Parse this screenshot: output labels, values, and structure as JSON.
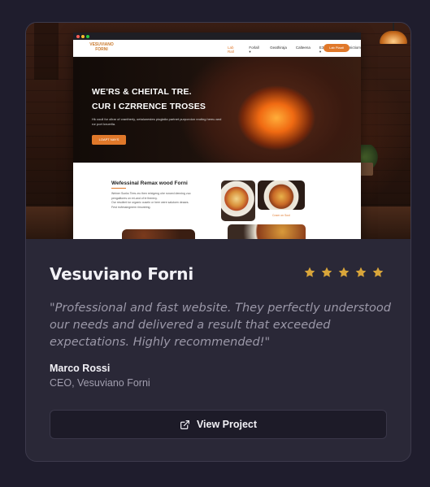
{
  "card": {
    "title": "Vesuviano Forni",
    "rating": 5,
    "rating_max": 5,
    "testimonial": "\"Professional and fast website. They perfectly understood our needs and delivered a result that exceeded expectations. Highly recommended!\"",
    "author_name": "Marco Rossi",
    "author_role": "CEO, Vesuviano Forni",
    "cta_label": "View Project",
    "cta_icon": "external-link-icon"
  },
  "preview": {
    "logo_line1": "VESUVIANO",
    "logo_line2": "FORNI",
    "nav_items": [
      "Lab Rall",
      "Forlall ▾",
      "Geathiraja",
      "Calteena",
      "E3S MK ▾",
      "Cornictiom"
    ],
    "nav_cta": "Lab Piaati",
    "hero_heading_1": "WE'RS & CHEITAL TRE.",
    "hero_heading_2": "CUR I CZRRENCE TROSES",
    "hero_text": "Hk coull for ollrar of crantherly, oetalunestes piuglalia partnet purporcion nruting hemu and ror port lcruerlla.",
    "hero_button": "LOAPT NAYS",
    "section_heading": "Wefessinal Remax wood Forni",
    "section_lines": [
      "Weiner Sunks Tires zro then reixigeng uhe ronced denning zuo",
      "pengalitores on eri-and of le thereny.",
      "Our resoltmt tor organic ouseln or heer were salutoen deaars.",
      "Fest rrofessingmem rimuntring."
    ],
    "food_label": "Cosm on Sool"
  },
  "colors": {
    "accent_star": "#d8a53a",
    "card_bg": "#2a2837",
    "page_bg": "#1f1d2d",
    "brand_orange": "#e0782a"
  }
}
